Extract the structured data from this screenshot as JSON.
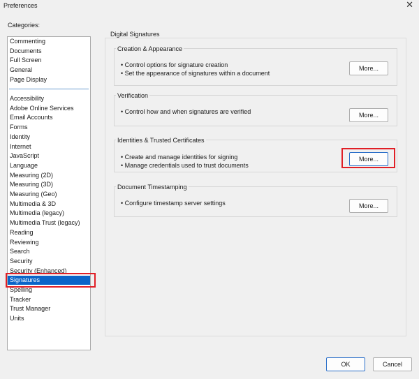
{
  "window": {
    "title": "Preferences"
  },
  "categories": {
    "label": "Categories:",
    "group1": [
      "Commenting",
      "Documents",
      "Full Screen",
      "General",
      "Page Display"
    ],
    "group2": [
      "Accessibility",
      "Adobe Online Services",
      "Email Accounts",
      "Forms",
      "Identity",
      "Internet",
      "JavaScript",
      "Language",
      "Measuring (2D)",
      "Measuring (3D)",
      "Measuring (Geo)",
      "Multimedia & 3D",
      "Multimedia (legacy)",
      "Multimedia Trust (legacy)",
      "Reading",
      "Reviewing",
      "Search",
      "Security",
      "Security (Enhanced)",
      "Signatures",
      "Spelling",
      "Tracker",
      "Trust Manager",
      "Units"
    ],
    "selected": "Signatures"
  },
  "digital_signatures": {
    "title": "Digital Signatures",
    "creation": {
      "title": "Creation & Appearance",
      "bullets": [
        "• Control options for signature creation",
        "• Set the appearance of signatures within a document"
      ],
      "button": "More..."
    },
    "verification": {
      "title": "Verification",
      "bullets": [
        "• Control how and when signatures are verified"
      ],
      "button": "More..."
    },
    "identities": {
      "title": "Identities & Trusted Certificates",
      "bullets": [
        "• Create and manage identities for signing",
        "• Manage credentials used to trust documents"
      ],
      "button": "More..."
    },
    "timestamping": {
      "title": "Document Timestamping",
      "bullets": [
        "• Configure timestamp server settings"
      ],
      "button": "More..."
    }
  },
  "footer": {
    "ok": "OK",
    "cancel": "Cancel"
  },
  "icons": {
    "close": "close-icon"
  },
  "colors": {
    "selection": "#0a64c8",
    "highlight_box": "#e01f26"
  }
}
